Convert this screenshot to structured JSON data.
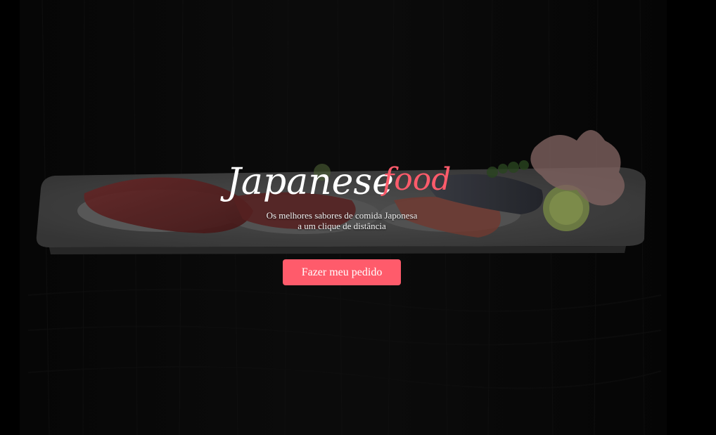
{
  "brand": {
    "word_main": "Japanese",
    "word_accent": "food",
    "main_color": "#ffffff",
    "accent_color": "#ff5b6b"
  },
  "hero": {
    "tagline_line1": "Os melhores sabores de comida Japonesa",
    "tagline_line2": "a um clique de distância",
    "background_image": "sushi-platter-photo"
  },
  "cta": {
    "label": "Fazer meu pedido",
    "color": "#ff5b6b"
  }
}
